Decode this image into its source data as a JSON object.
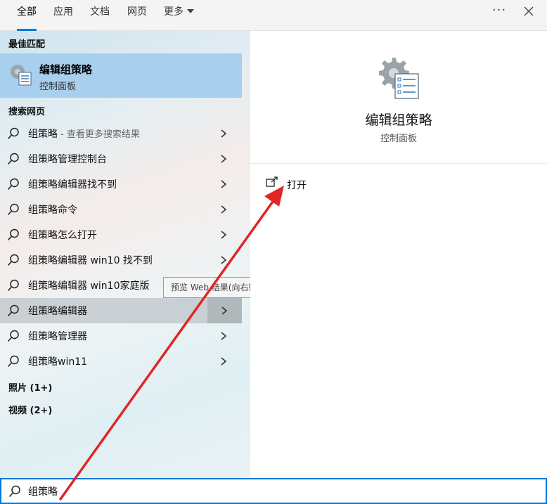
{
  "tabs": [
    {
      "label": "全部"
    },
    {
      "label": "应用"
    },
    {
      "label": "文档"
    },
    {
      "label": "网页"
    },
    {
      "label": "更多"
    }
  ],
  "window": {
    "more_options_icon": "ellipsis-icon",
    "close_icon": "close-icon"
  },
  "left": {
    "best_match_heading": "最佳匹配",
    "best_match": {
      "title": "编辑组策略",
      "subtitle": "控制面板",
      "icon": "group-policy-icon"
    },
    "web_heading": "搜索网页",
    "web_results": [
      {
        "text": "组策略",
        "hint": "- 查看更多搜索结果"
      },
      {
        "text": "组策略管理控制台",
        "hint": ""
      },
      {
        "text": "组策略编辑器找不到",
        "hint": ""
      },
      {
        "text": "组策略命令",
        "hint": ""
      },
      {
        "text": "组策略怎么打开",
        "hint": ""
      },
      {
        "text": "组策略编辑器 win10 找不到",
        "hint": ""
      },
      {
        "text": "组策略编辑器 win10家庭版",
        "hint": ""
      },
      {
        "text": "组策略编辑器",
        "hint": ""
      },
      {
        "text": "组策略管理器",
        "hint": ""
      },
      {
        "text": "组策略win11",
        "hint": ""
      }
    ],
    "photos_heading": "照片 (1+)",
    "videos_heading": "视频 (2+)",
    "tooltip": "预览 Web 结果(向右键)"
  },
  "right": {
    "title": "编辑组策略",
    "subtitle": "控制面板",
    "actions": [
      {
        "label": "打开",
        "icon": "open-icon"
      }
    ]
  },
  "search": {
    "value": "组策略",
    "icon": "search-icon"
  },
  "colors": {
    "accent": "#0078d7",
    "best_match_bg": "#a9cfee",
    "annotation_arrow": "#e02626"
  }
}
